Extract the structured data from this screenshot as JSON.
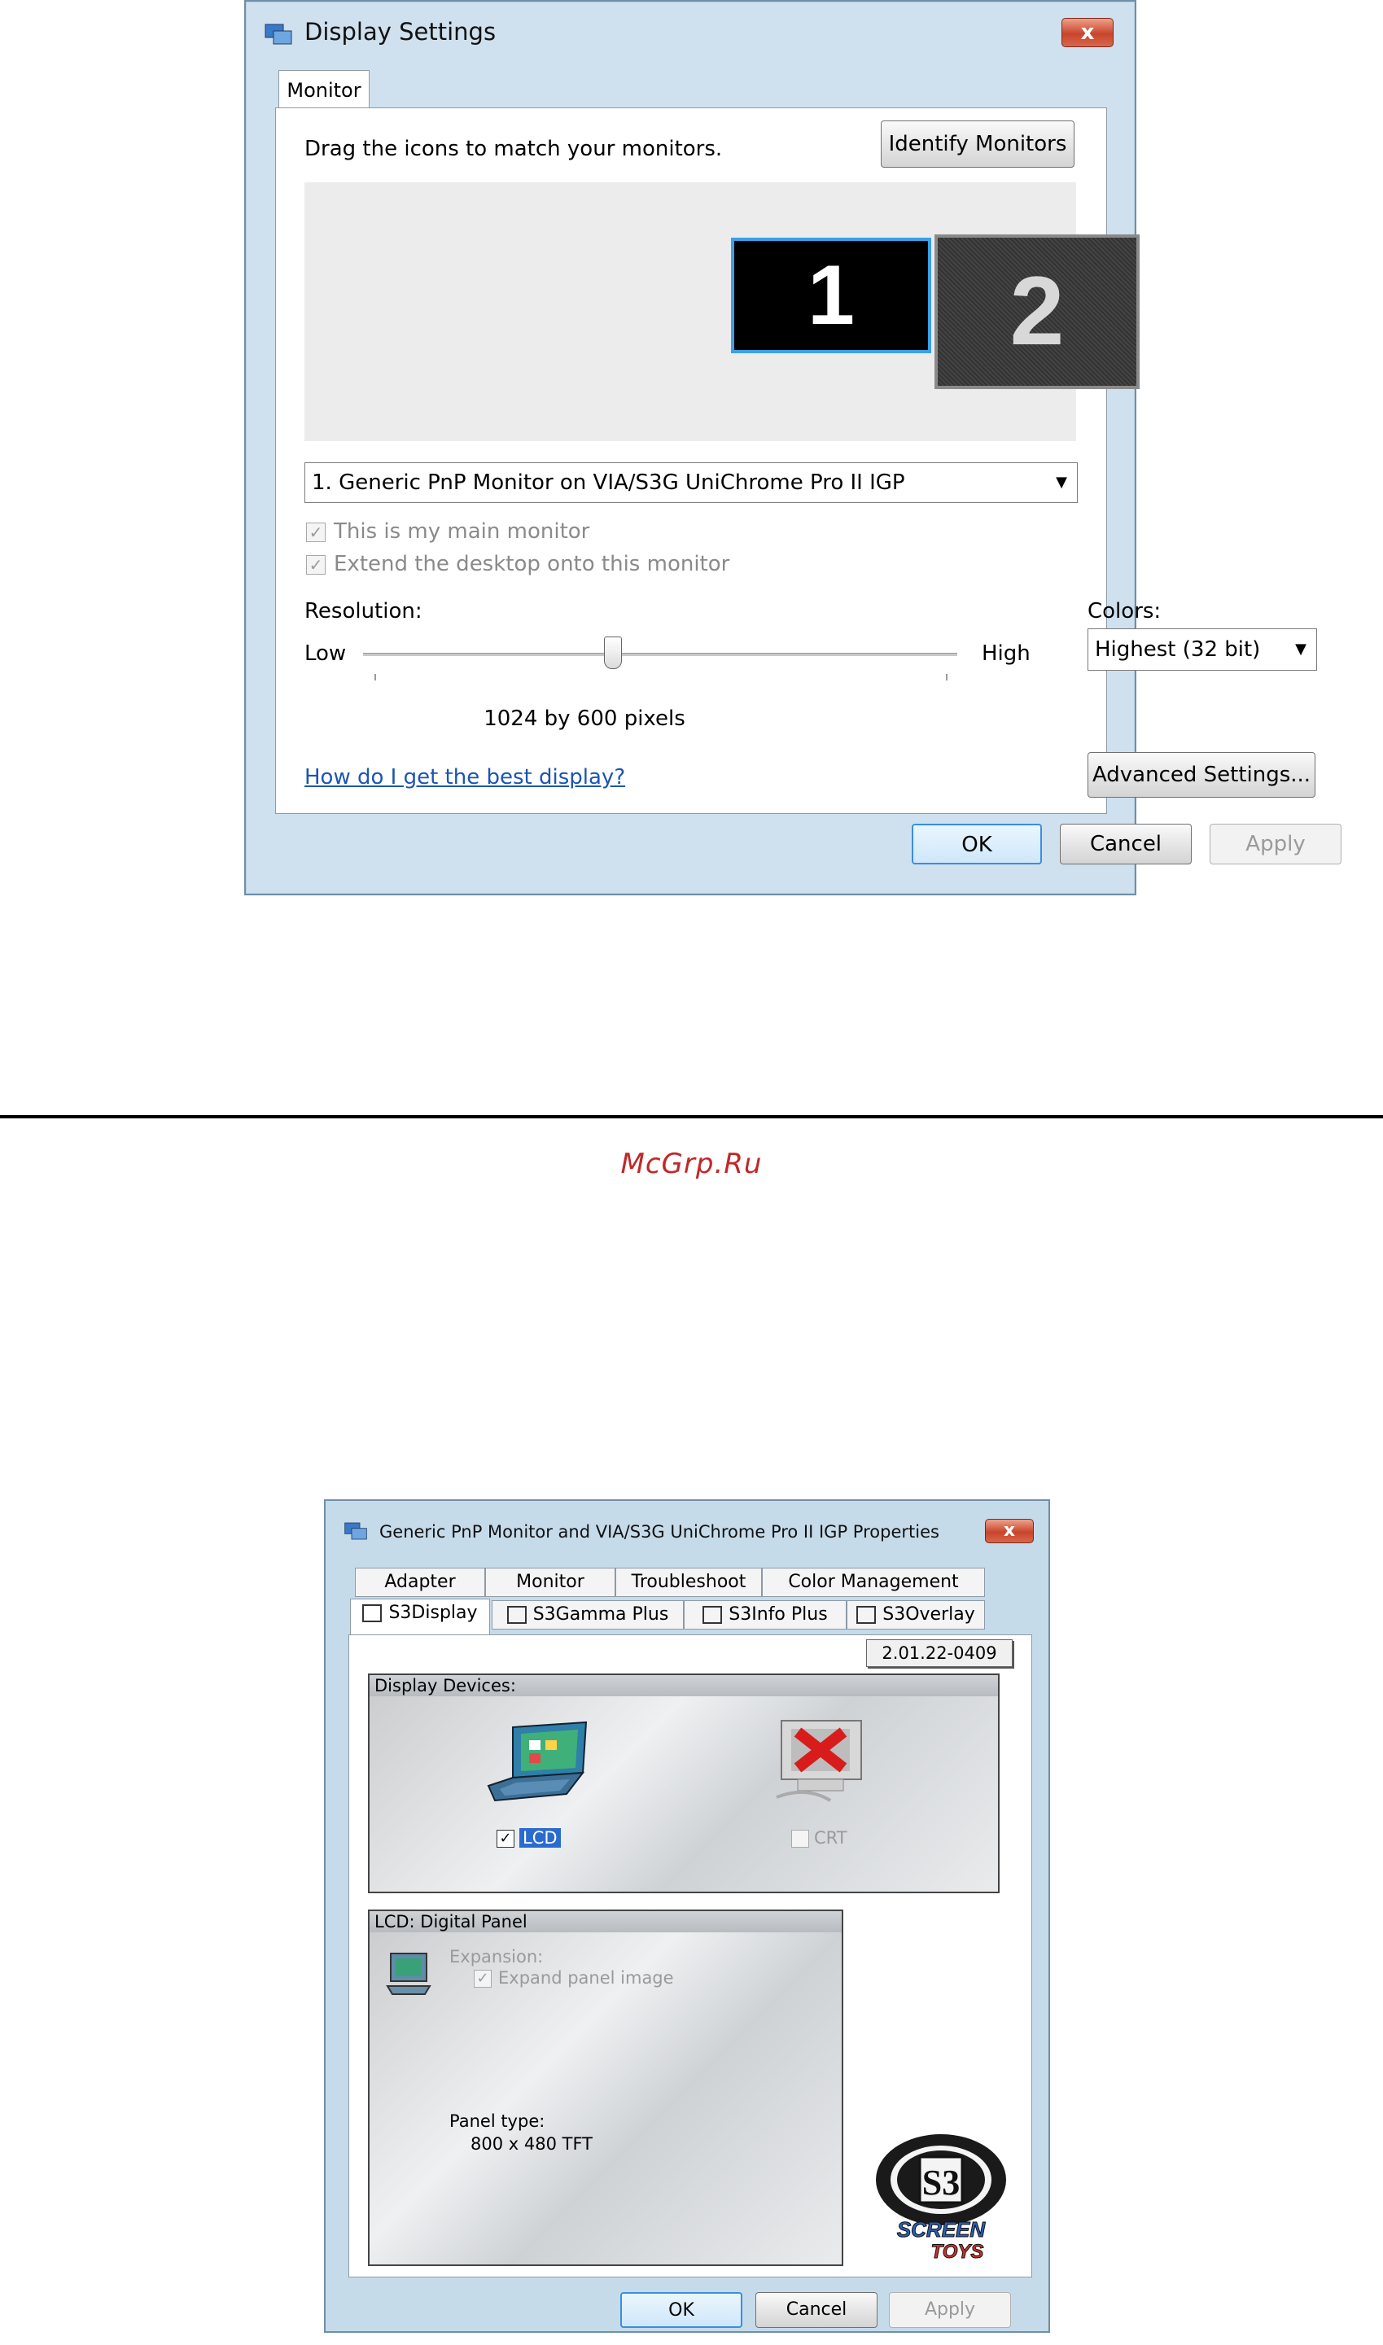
{
  "display_settings": {
    "title": "Display Settings",
    "close_label": "x",
    "tab_label": "Monitor",
    "drag_hint": "Drag the icons to match your monitors.",
    "identify_label": "Identify Monitors",
    "monitor1_number": "1",
    "monitor2_number": "2",
    "monitor_select_value": "1. Generic PnP Monitor on VIA/S3G UniChrome Pro II IGP",
    "main_monitor_label": "This is my main monitor",
    "extend_label": "Extend the desktop onto this monitor",
    "main_monitor_checked": true,
    "extend_checked": true,
    "resolution_label": "Resolution:",
    "low_label": "Low",
    "high_label": "High",
    "resolution_slider_fraction": 0.42,
    "resolution_value": "1024 by 600 pixels",
    "colors_label": "Colors:",
    "colors_value": "Highest (32 bit)",
    "help_link": "How do I get the best display?",
    "advanced_label": "Advanced Settings...",
    "ok_label": "OK",
    "cancel_label": "Cancel",
    "apply_label": "Apply",
    "check_mark": "✓",
    "dropdown_arrow": "▼"
  },
  "caption": "McGrp.Ru",
  "s3_properties": {
    "title": "Generic PnP Monitor and VIA/S3G UniChrome Pro II IGP Properties",
    "close_label": "x",
    "tabs_row1": [
      "Adapter",
      "Monitor",
      "Troubleshoot",
      "Color Management"
    ],
    "tabs_row2": [
      "S3Display",
      "S3Gamma Plus",
      "S3Info Plus",
      "S3Overlay"
    ],
    "active_tab": "S3Display",
    "version": "2.01.22-0409",
    "display_devices_label": "Display Devices:",
    "lcd_label": "LCD",
    "lcd_checked": true,
    "crt_label": "CRT",
    "crt_checked": false,
    "lcd_panel_header": "LCD: Digital Panel",
    "expansion_label": "Expansion:",
    "expand_panel_label": "Expand panel image",
    "expand_checked": true,
    "panel_type_label": "Panel type:",
    "panel_type_value": "800 x 480 TFT",
    "logo_text": "S3",
    "logo_sub": "SCREEN TOYS",
    "ok_label": "OK",
    "cancel_label": "Cancel",
    "apply_label": "Apply",
    "check_mark": "✓"
  }
}
